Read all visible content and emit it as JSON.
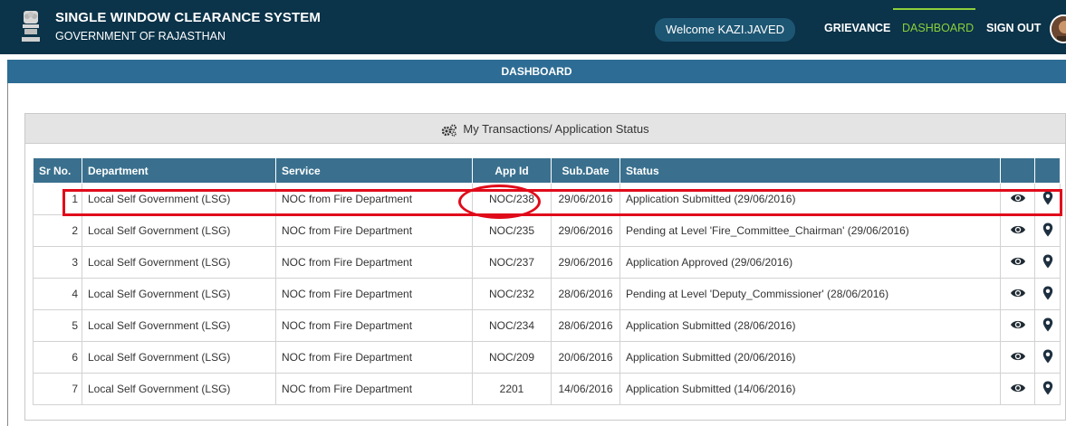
{
  "header": {
    "title": "SINGLE WINDOW CLEARANCE SYSTEM",
    "subtitle": "GOVERNMENT OF RAJASTHAN",
    "welcome": "Welcome KAZI.JAVED",
    "nav": {
      "grievance": "GRIEVANCE",
      "dashboard": "DASHBOARD",
      "signout": "SIGN OUT"
    },
    "accent_color": "#8ccf3a",
    "bg_color": "#0b3349"
  },
  "bar": {
    "label": "DASHBOARD"
  },
  "panel": {
    "title": "My Transactions/ Application Status",
    "icon": "gears-icon"
  },
  "table": {
    "columns": [
      "Sr No.",
      "Department",
      "Service",
      "App Id",
      "Sub.Date",
      "Status",
      "",
      ""
    ],
    "rows": [
      {
        "sr": "1",
        "department": "Local Self Government (LSG)",
        "service": "NOC from Fire Department",
        "app_id": "NOC/238",
        "date": "29/06/2016",
        "status": "Application Submitted (29/06/2016)"
      },
      {
        "sr": "2",
        "department": "Local Self Government (LSG)",
        "service": "NOC from Fire Department",
        "app_id": "NOC/235",
        "date": "29/06/2016",
        "status": "Pending at Level 'Fire_Committee_Chairman' (29/06/2016)"
      },
      {
        "sr": "3",
        "department": "Local Self Government (LSG)",
        "service": "NOC from Fire Department",
        "app_id": "NOC/237",
        "date": "29/06/2016",
        "status": "Application Approved (29/06/2016)"
      },
      {
        "sr": "4",
        "department": "Local Self Government (LSG)",
        "service": "NOC from Fire Department",
        "app_id": "NOC/232",
        "date": "28/06/2016",
        "status": "Pending at Level 'Deputy_Commissioner' (28/06/2016)"
      },
      {
        "sr": "5",
        "department": "Local Self Government (LSG)",
        "service": "NOC from Fire Department",
        "app_id": "NOC/234",
        "date": "28/06/2016",
        "status": "Application Submitted (28/06/2016)"
      },
      {
        "sr": "6",
        "department": "Local Self Government (LSG)",
        "service": "NOC from Fire Department",
        "app_id": "NOC/209",
        "date": "20/06/2016",
        "status": "Application Submitted (20/06/2016)"
      },
      {
        "sr": "7",
        "department": "Local Self Government (LSG)",
        "service": "NOC from Fire Department",
        "app_id": "2201",
        "date": "14/06/2016",
        "status": "Application Submitted (14/06/2016)"
      }
    ],
    "header_color": "#3a708e",
    "highlight_color": "#e00b1a"
  }
}
